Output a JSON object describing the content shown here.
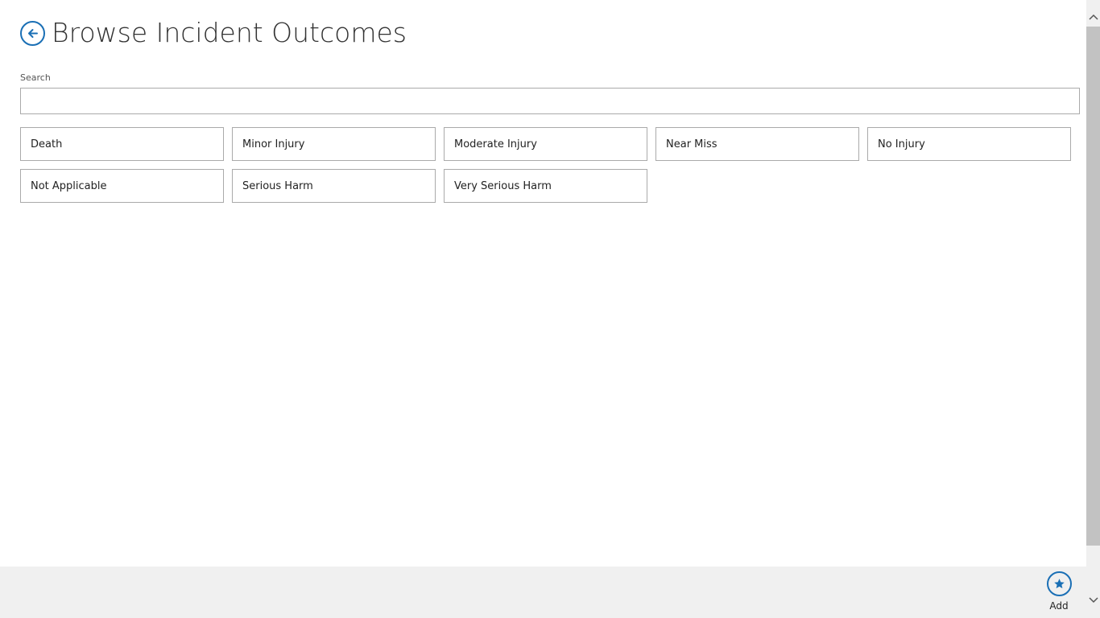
{
  "header": {
    "title": "Browse Incident Outcomes",
    "back_icon": "back-arrow-icon"
  },
  "search": {
    "label": "Search",
    "value": "",
    "placeholder": ""
  },
  "outcomes": [
    "Death",
    "Minor Injury",
    "Moderate Injury",
    "Near Miss",
    "No Injury",
    "Not Applicable",
    "Serious Harm",
    "Very Serious Harm"
  ],
  "app_bar": {
    "add_label": "Add",
    "add_icon": "star-icon"
  },
  "colors": {
    "accent": "#1a6fb5",
    "app_bar_background": "#f0f0f0",
    "tile_border": "#aaaaaa",
    "scroll_thumb": "#c2c2c2"
  }
}
